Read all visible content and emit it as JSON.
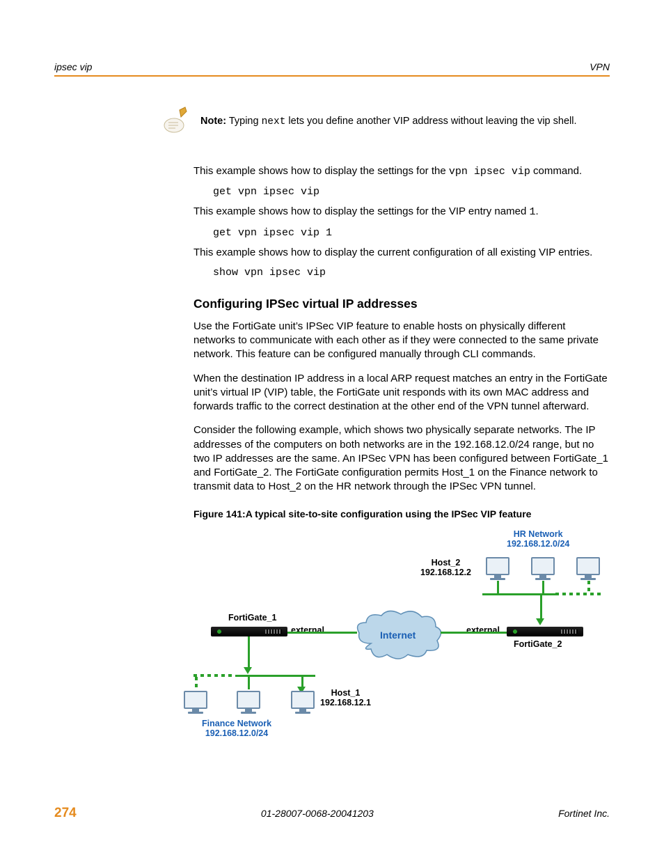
{
  "header": {
    "left": "ipsec vip",
    "right": "VPN"
  },
  "note": {
    "label": "Note:",
    "text_before": " Typing ",
    "code": "next",
    "text_after": " lets you define another VIP address without leaving the vip shell."
  },
  "body": {
    "p1_a": "This example shows how to display the settings for the ",
    "p1_code": "vpn ipsec vip",
    "p1_b": " command.",
    "code1": "get vpn ipsec vip",
    "p2_a": "This example shows how to display the settings for the VIP entry named ",
    "p2_code": "1",
    "p2_b": ".",
    "code2": "get vpn ipsec vip 1",
    "p3": "This example shows how to display the current configuration of all existing VIP entries.",
    "code3": "show vpn ipsec vip"
  },
  "section_heading": "Configuring IPSec virtual IP addresses",
  "section": {
    "para1": "Use the FortiGate unit’s IPSec VIP feature to enable hosts on physically different networks to communicate with each other as if they were connected to the same private network. This feature can be configured manually through CLI commands.",
    "para2": "When the destination IP address in a local ARP request matches an entry in the FortiGate unit’s virtual IP (VIP) table, the FortiGate unit responds with its own MAC address and forwards traffic to the correct destination at the other end of the VPN tunnel afterward.",
    "para3": "Consider the following example, which shows two physically separate networks. The IP addresses of the computers on both networks are in the 192.168.12.0/24 range, but no two IP addresses are the same. An IPSec VPN has been configured between FortiGate_1 and FortiGate_2. The FortiGate configuration permits Host_1 on the Finance network to transmit data to Host_2 on the HR network through the IPSec VPN tunnel."
  },
  "figure_caption": "Figure 141:A typical site-to-site configuration using the IPSec VIP feature",
  "diagram": {
    "hr_network_l1": "HR Network",
    "hr_network_l2": "192.168.12.0/24",
    "host2_l1": "Host_2",
    "host2_l2": "192.168.12.2",
    "fortigate1": "FortiGate_1",
    "fortigate2": "FortiGate_2",
    "external1": "external",
    "external2": "external",
    "internet": "Internet",
    "host1_l1": "Host_1",
    "host1_l2": "192.168.12.1",
    "finance_l1": "Finance Network",
    "finance_l2": "192.168.12.0/24"
  },
  "footer": {
    "page": "274",
    "docid": "01-28007-0068-20041203",
    "company": "Fortinet Inc."
  }
}
